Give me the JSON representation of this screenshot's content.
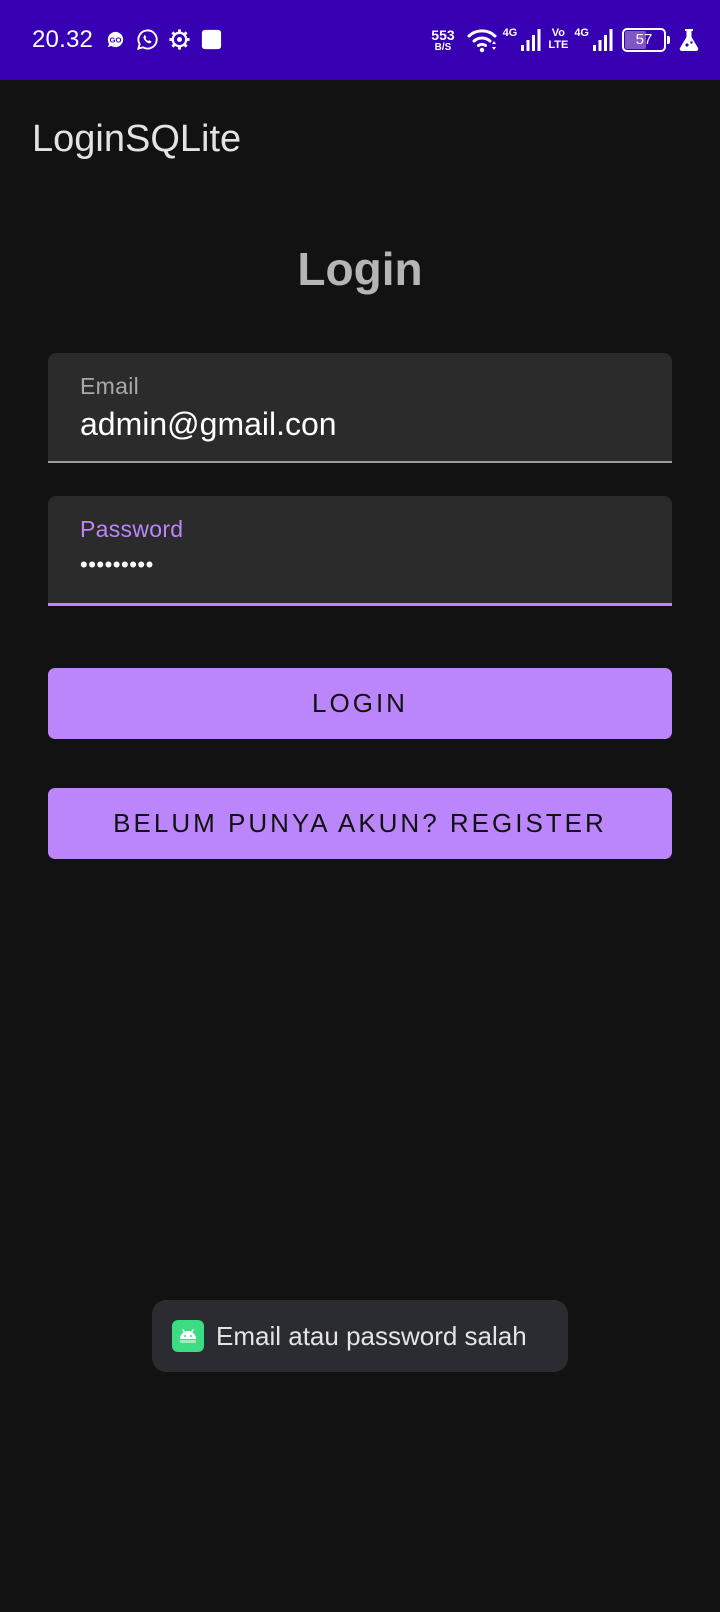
{
  "status_bar": {
    "time": "20.32",
    "left_icons": [
      "go-icon",
      "whatsapp-icon",
      "settings-icon",
      "app-square-icon"
    ],
    "net_speed": "553",
    "net_speed_unit": "B/S",
    "sim1_tech": "4G",
    "volte_top": "Vo",
    "volte_bottom": "LTE",
    "sim2_tech": "4G",
    "battery_level": 57,
    "battery_text": "57"
  },
  "app_bar": {
    "title": "LoginSQLite"
  },
  "form": {
    "heading": "Login",
    "email": {
      "label": "Email",
      "value": "admin@gmail.con"
    },
    "password": {
      "label": "Password",
      "value": "•••••••••"
    }
  },
  "buttons": {
    "login": "LOGIN",
    "register": "BELUM PUNYA AKUN? REGISTER"
  },
  "toast": {
    "message": "Email atau password salah",
    "icon": "android-icon"
  },
  "colors": {
    "status_bar": "#3700b3",
    "background": "#121212",
    "accent": "#bb86fc",
    "field_background": "#2b2b2b",
    "toast_background": "#2a2c31"
  }
}
